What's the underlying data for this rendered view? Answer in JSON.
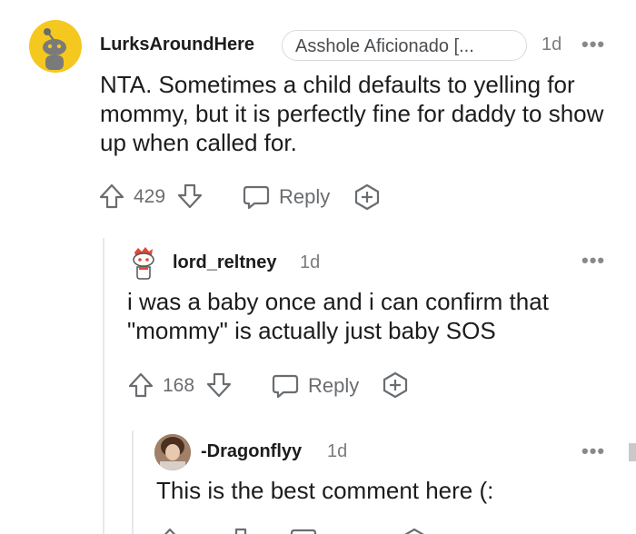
{
  "comments": [
    {
      "username": "LurksAroundHere",
      "flair": "Asshole Aficionado [...",
      "time": "1d",
      "more": "•••",
      "body": "NTA. Sometimes a child defaults to yelling for mommy, but it is perfectly fine for daddy to show up when called for.",
      "votes": "429",
      "reply_label": "Reply"
    },
    {
      "username": "lord_reltney",
      "time": "1d",
      "more": "•••",
      "body": "i was a baby once and i can confirm that \"mommy\" is actually just baby SOS",
      "votes": "168",
      "reply_label": "Reply"
    },
    {
      "username": "-Dragonflyy",
      "time": "1d",
      "more": "•••",
      "body": "This is the best comment here (:"
    }
  ],
  "colors": {
    "avatar_yellow": "#f5c820",
    "meta_gray": "#7c7c7c",
    "icon_gray": "#6a6d70",
    "thread_line": "#e6e8ea"
  }
}
